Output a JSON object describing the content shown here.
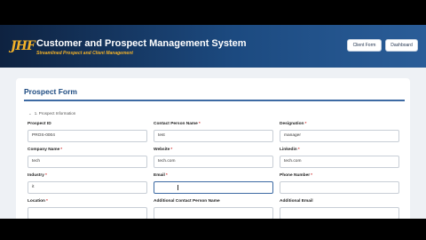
{
  "header": {
    "logo_text": "JHF",
    "title": "Customer and Prospect Management System",
    "subtitle": "Streamlined Prospect and Client Management",
    "buttons": {
      "client_form": "Client Form",
      "dashboard": "Dashboard"
    }
  },
  "form": {
    "title": "Prospect Form",
    "section": {
      "label": "1. Prospect Information",
      "icon": "chevron-down-icon"
    },
    "fields": {
      "prospect_id": {
        "label": "Prospect ID",
        "value": "PROS-0004"
      },
      "contact_person_name": {
        "label": "Contact Person Name",
        "required": "*",
        "value": "test"
      },
      "designation": {
        "label": "Designation",
        "required": "*",
        "value": "manager"
      },
      "company_name": {
        "label": "Company Name",
        "required": "*",
        "value": "tech"
      },
      "website": {
        "label": "Website",
        "required": "*",
        "value": "tech.com"
      },
      "linkedin": {
        "label": "Linkedin",
        "required": "*",
        "value": "tech.com"
      },
      "industry": {
        "label": "Industry",
        "required": "*",
        "value": "it"
      },
      "email": {
        "label": "Email",
        "required": "*",
        "value": ""
      },
      "phone_number": {
        "label": "Phone Number",
        "required": "*",
        "value": ""
      },
      "location": {
        "label": "Location",
        "required": "*",
        "value": ""
      },
      "additional_contact_person_name": {
        "label": "Additional Contact Person Name",
        "value": ""
      },
      "additional_email": {
        "label": "Additional Email",
        "value": ""
      }
    }
  },
  "colors": {
    "header_dark": "#0e2240",
    "header_light": "#2a5d98",
    "accent_gold": "#f3b229",
    "title_blue": "#1c4a80",
    "required_red": "#d23a3a"
  }
}
